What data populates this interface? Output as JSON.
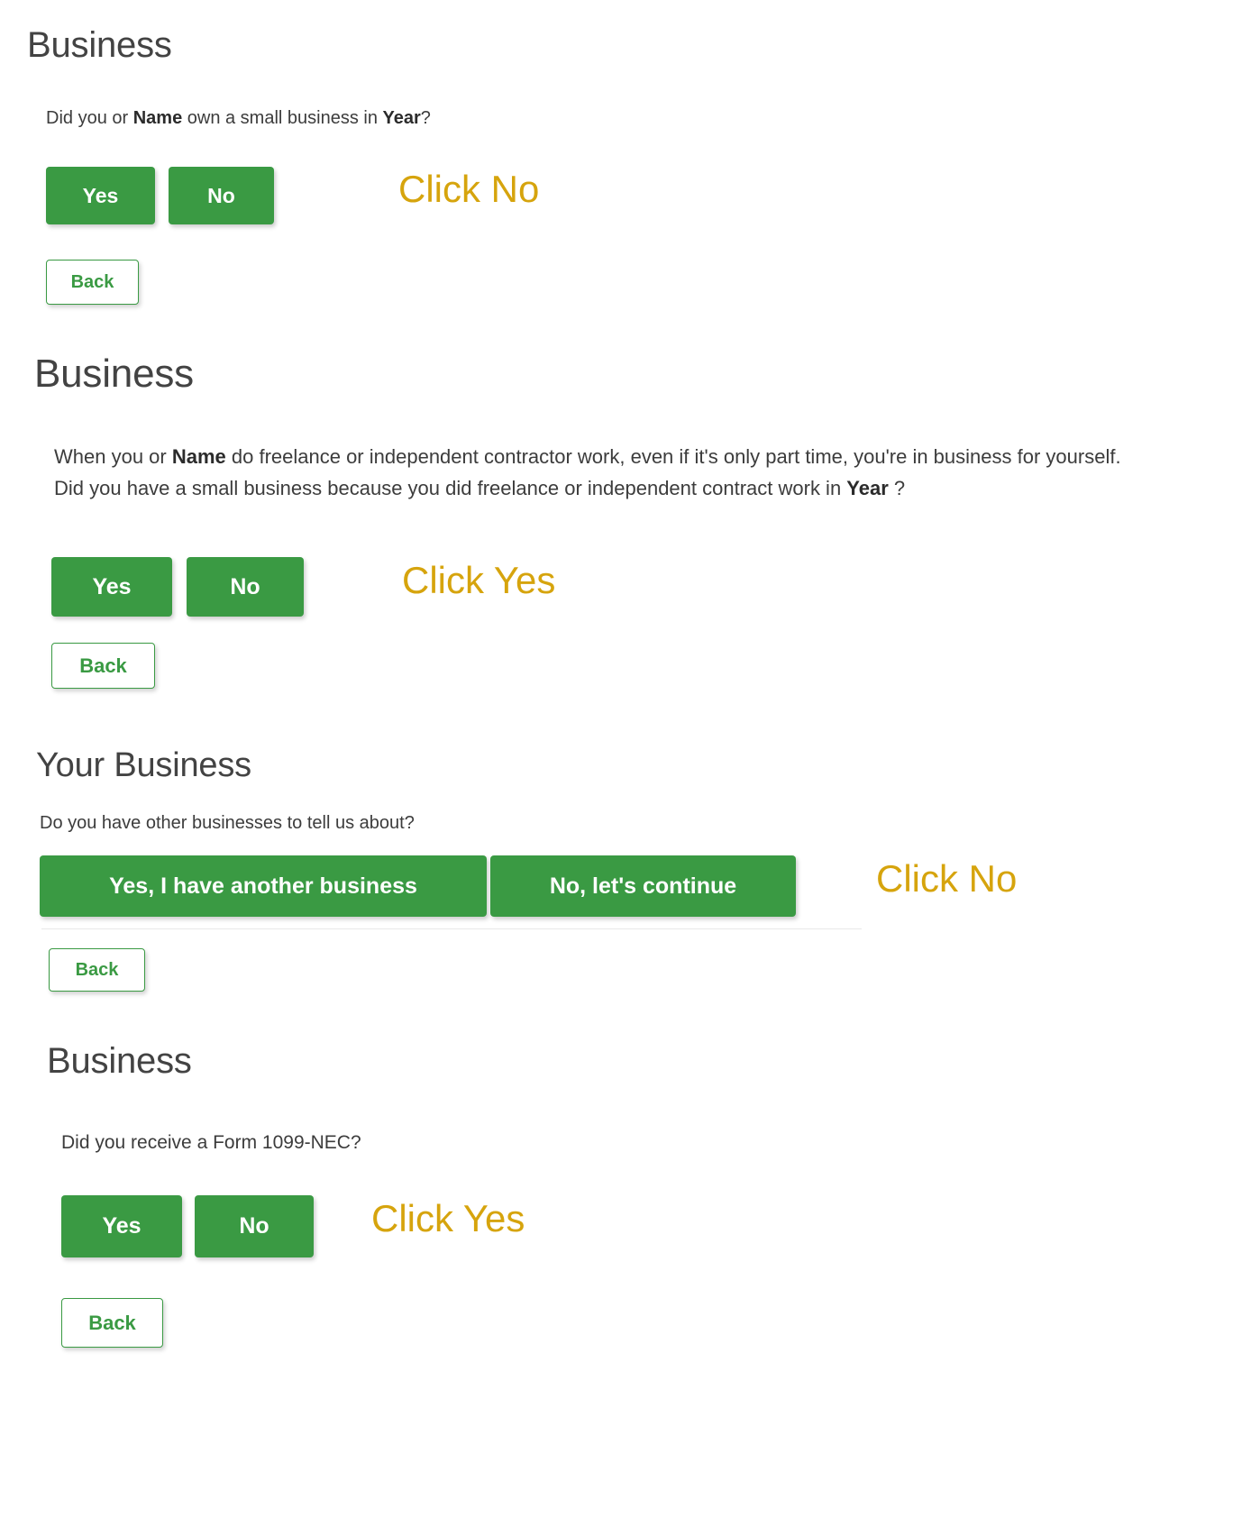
{
  "theme": {
    "primary_green": "#3a9a43",
    "hint_orange": "#d6a40d",
    "heading_gray": "#434343",
    "body_gray": "#3c3c3c",
    "page_background": "#ffffff"
  },
  "sections": [
    {
      "id": "business-own-small-business",
      "title": "Business",
      "question": {
        "part1": "Did you or ",
        "emphasis1": "Name",
        "part2": " own a small business in ",
        "emphasis2": "Year",
        "part3": "?"
      },
      "buttons": {
        "yes": "Yes",
        "no": "No",
        "back": "Back"
      },
      "hint": "Click No"
    },
    {
      "id": "business-freelance-contractor",
      "title": "Business",
      "question": {
        "part1": "When you or ",
        "emphasis1": "Name",
        "part2": " do freelance or independent contractor work, even if it's only part time, you're in business for yourself. Did you have a small business because you did freelance or independent contract work in ",
        "emphasis2": "Year",
        "part3": " ?"
      },
      "buttons": {
        "yes": "Yes",
        "no": "No",
        "back": "Back"
      },
      "hint": "Click Yes"
    },
    {
      "id": "your-business-other-businesses",
      "title": "Your Business",
      "question": {
        "full": "Do you have other businesses to tell us about?"
      },
      "buttons": {
        "yes": "Yes, I have another business",
        "no": "No, let's continue",
        "back": "Back"
      },
      "hint": "Click No"
    },
    {
      "id": "business-form-1099-nec",
      "title": "Business",
      "question": {
        "full": "Did you receive a Form 1099-NEC?"
      },
      "buttons": {
        "yes": "Yes",
        "no": "No",
        "back": "Back"
      },
      "hint": "Click Yes"
    }
  ]
}
